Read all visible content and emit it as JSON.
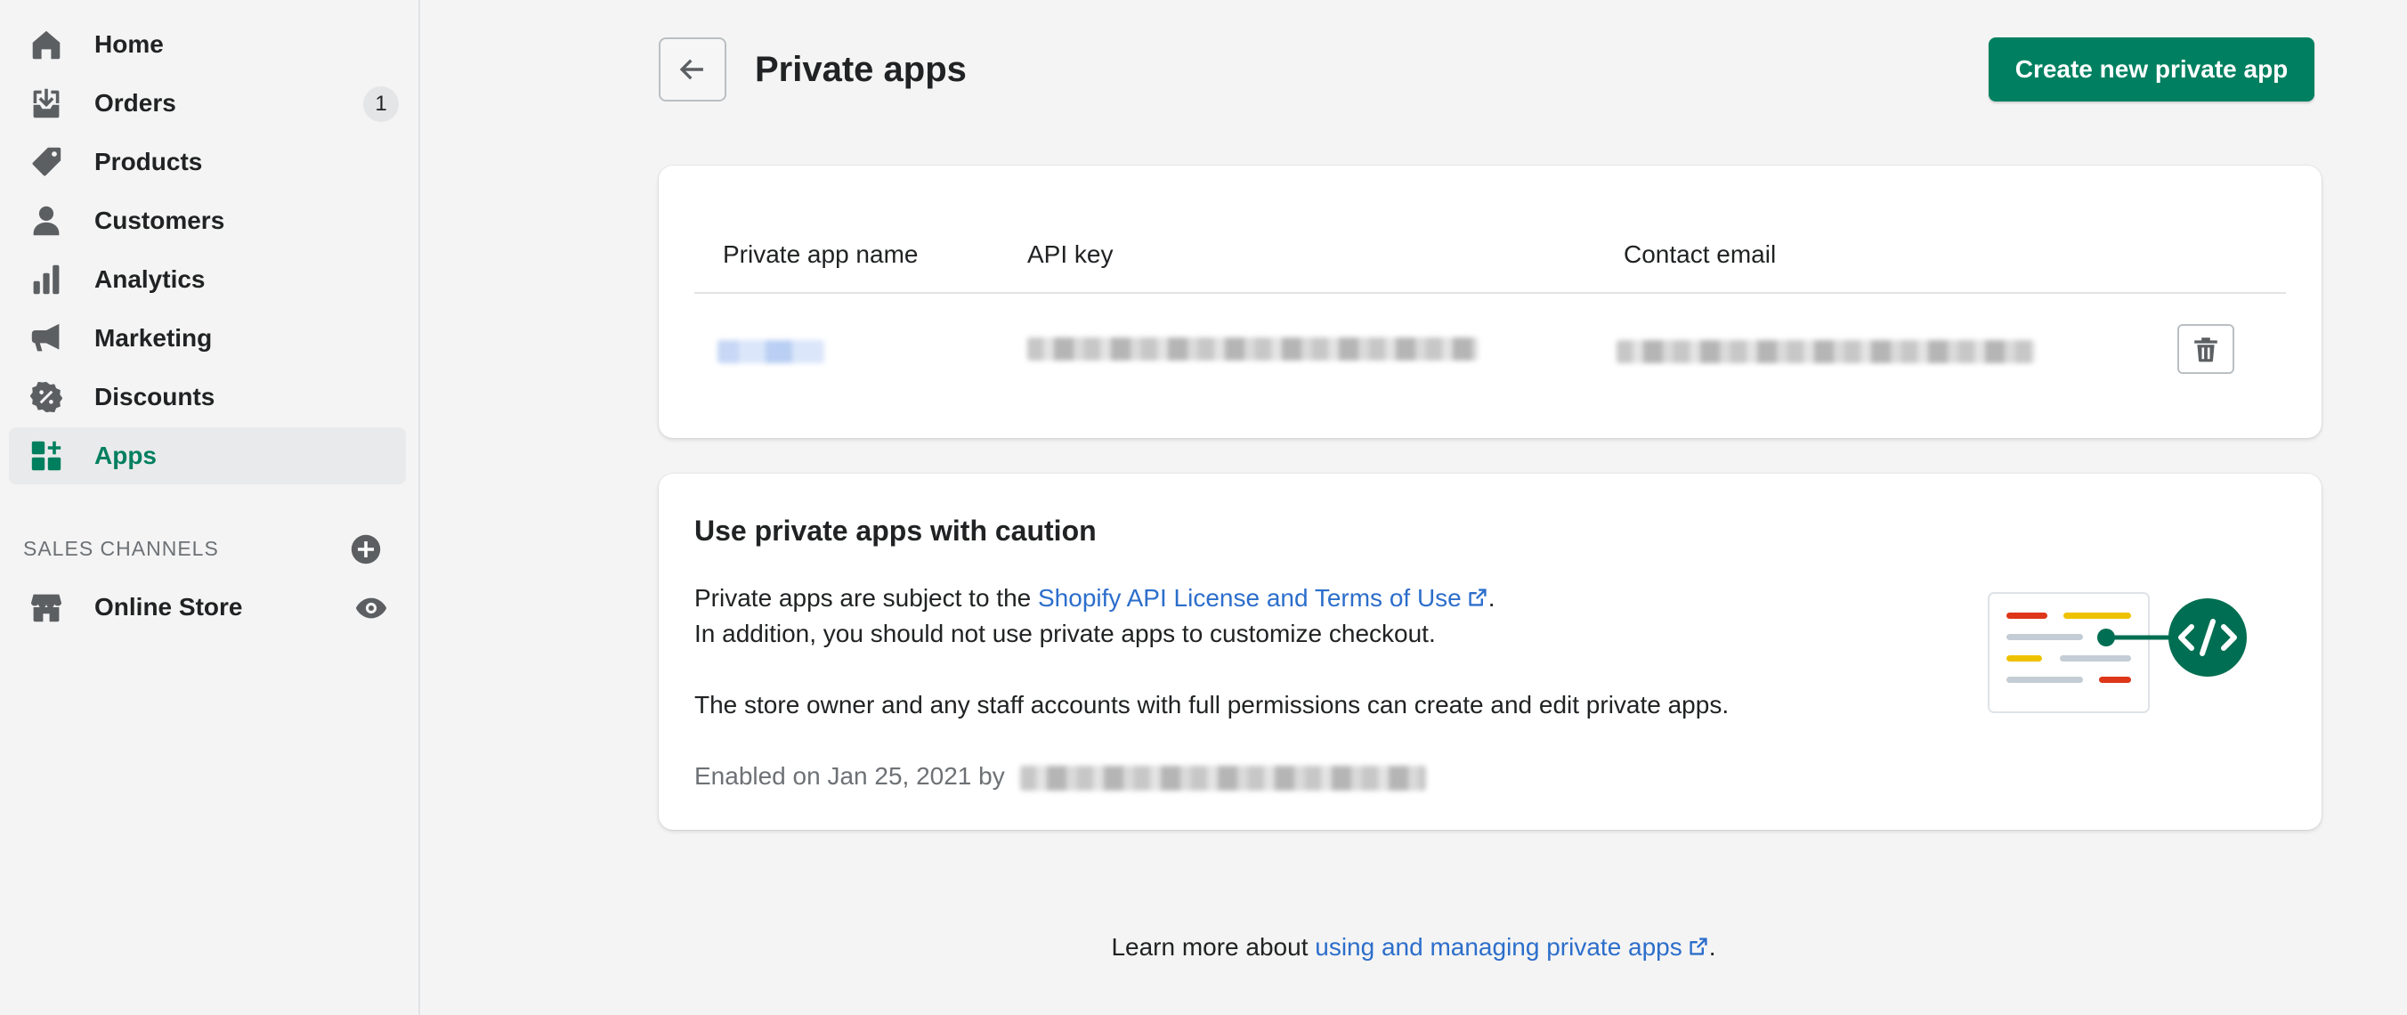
{
  "sidebar": {
    "items": [
      {
        "label": "Home",
        "icon": "home-icon"
      },
      {
        "label": "Orders",
        "icon": "orders-icon",
        "badge": "1"
      },
      {
        "label": "Products",
        "icon": "tag-icon"
      },
      {
        "label": "Customers",
        "icon": "person-icon"
      },
      {
        "label": "Analytics",
        "icon": "bar-chart-icon"
      },
      {
        "label": "Marketing",
        "icon": "megaphone-icon"
      },
      {
        "label": "Discounts",
        "icon": "discount-icon"
      },
      {
        "label": "Apps",
        "icon": "apps-icon",
        "active": true
      }
    ],
    "sales_channels": {
      "heading": "SALES CHANNELS",
      "items": [
        {
          "label": "Online Store",
          "icon": "store-icon"
        }
      ]
    }
  },
  "header": {
    "title": "Private apps",
    "create_button": "Create new private app"
  },
  "apps_table": {
    "columns": [
      "Private app name",
      "API key",
      "Contact email"
    ]
  },
  "caution_card": {
    "heading": "Use private apps with caution",
    "line1_prefix": "Private apps are subject to the ",
    "line1_link": "Shopify API License and Terms of Use",
    "line1_suffix": ".",
    "line2": "In addition, you should not use private apps to customize checkout.",
    "line3": "The store owner and any staff accounts with full permissions can create and edit private apps.",
    "enabled_prefix": "Enabled on Jan 25, 2021 by "
  },
  "footer": {
    "prefix": "Learn more about ",
    "link": "using and managing private apps",
    "suffix": "."
  },
  "colors": {
    "accent": "#008060",
    "link": "#2c6ecb",
    "active_nav_text": "#007f5f"
  }
}
